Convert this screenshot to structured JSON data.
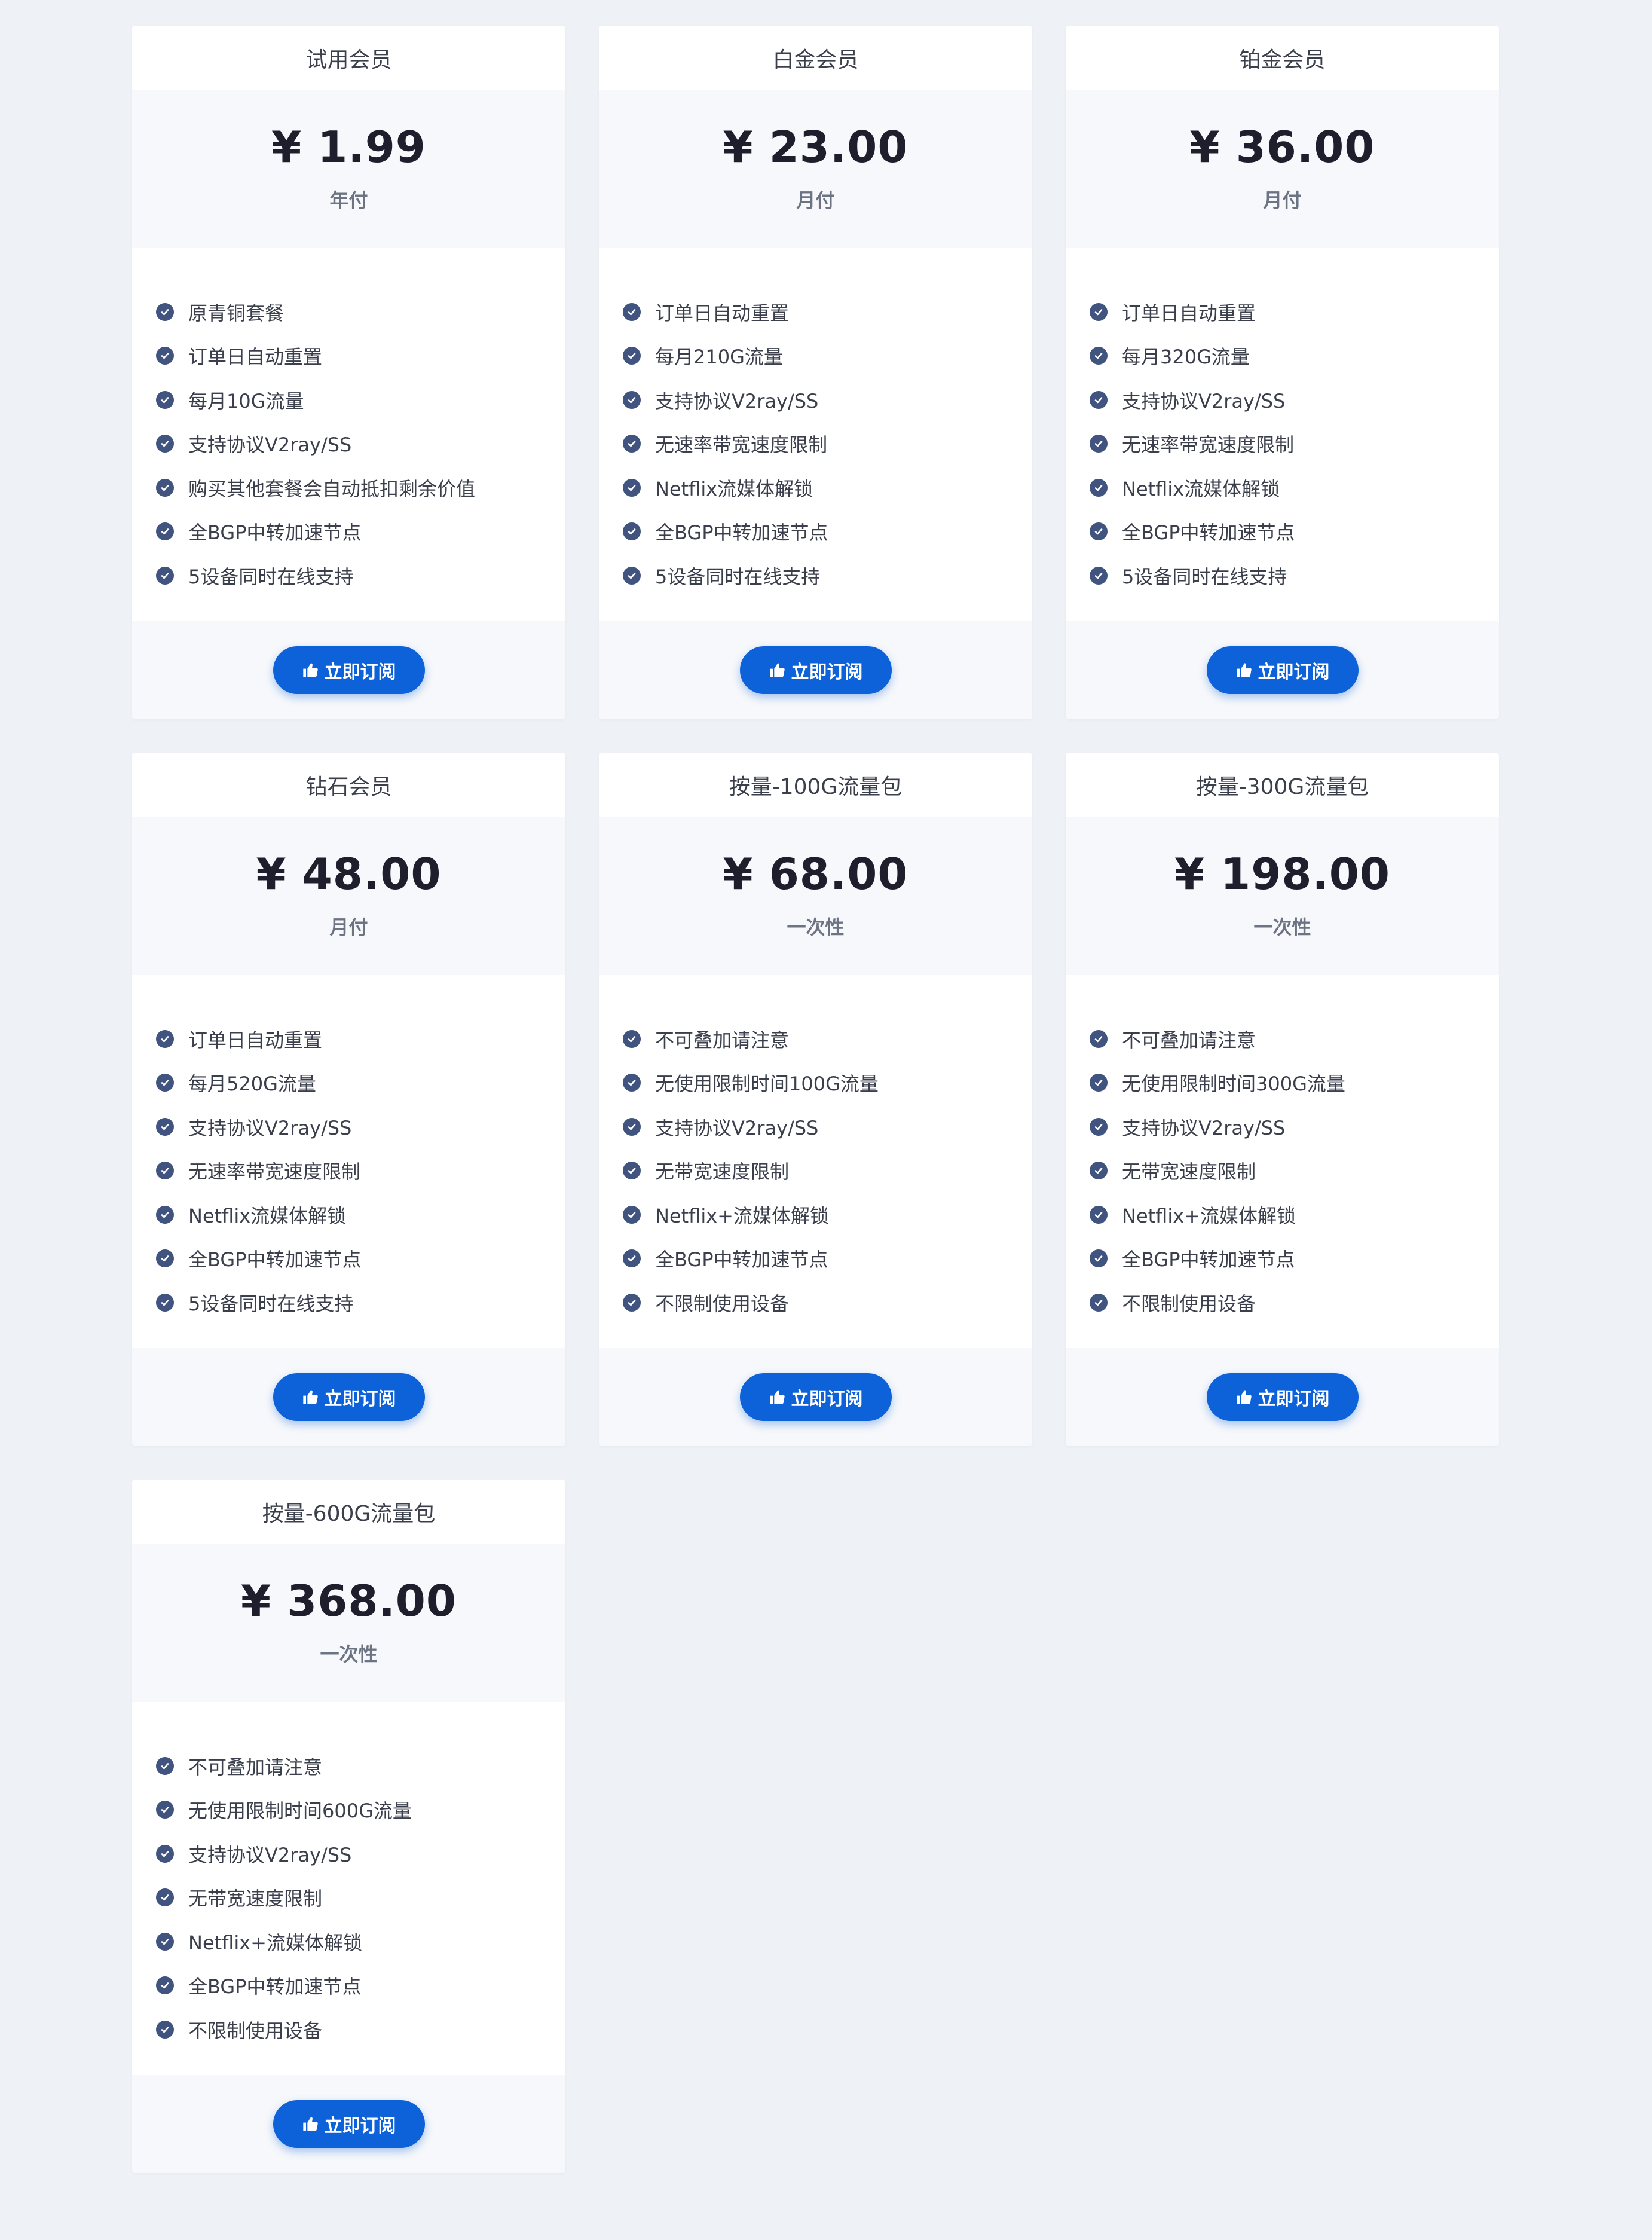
{
  "plans": [
    {
      "name": "试用会员",
      "price": "¥ 1.99",
      "period": "年付",
      "features": [
        "原青铜套餐",
        "订单日自动重置",
        "每月10G流量",
        "支持协议V2ray/SS",
        "购买其他套餐会自动抵扣剩余价值",
        "全BGP中转加速节点",
        "5设备同时在线支持"
      ],
      "button": "立即订阅"
    },
    {
      "name": "白金会员",
      "price": "¥ 23.00",
      "period": "月付",
      "features": [
        "订单日自动重置",
        "每月210G流量",
        "支持协议V2ray/SS",
        "无速率带宽速度限制",
        "Netflix流媒体解锁",
        "全BGP中转加速节点",
        "5设备同时在线支持"
      ],
      "button": "立即订阅"
    },
    {
      "name": "铂金会员",
      "price": "¥ 36.00",
      "period": "月付",
      "features": [
        "订单日自动重置",
        "每月320G流量",
        "支持协议V2ray/SS",
        "无速率带宽速度限制",
        "Netflix流媒体解锁",
        "全BGP中转加速节点",
        "5设备同时在线支持"
      ],
      "button": "立即订阅"
    },
    {
      "name": "钻石会员",
      "price": "¥ 48.00",
      "period": "月付",
      "features": [
        "订单日自动重置",
        "每月520G流量",
        "支持协议V2ray/SS",
        "无速率带宽速度限制",
        "Netflix流媒体解锁",
        "全BGP中转加速节点",
        "5设备同时在线支持"
      ],
      "button": "立即订阅"
    },
    {
      "name": "按量-100G流量包",
      "price": "¥ 68.00",
      "period": "一次性",
      "features": [
        "不可叠加请注意",
        "无使用限制时间100G流量",
        "支持协议V2ray/SS",
        "无带宽速度限制",
        "Netflix+流媒体解锁",
        "全BGP中转加速节点",
        "不限制使用设备"
      ],
      "button": "立即订阅"
    },
    {
      "name": "按量-300G流量包",
      "price": "¥ 198.00",
      "period": "一次性",
      "features": [
        "不可叠加请注意",
        "无使用限制时间300G流量",
        "支持协议V2ray/SS",
        "无带宽速度限制",
        "Netflix+流媒体解锁",
        "全BGP中转加速节点",
        "不限制使用设备"
      ],
      "button": "立即订阅"
    },
    {
      "name": "按量-600G流量包",
      "price": "¥ 368.00",
      "period": "一次性",
      "features": [
        "不可叠加请注意",
        "无使用限制时间600G流量",
        "支持协议V2ray/SS",
        "无带宽速度限制",
        "Netflix+流媒体解锁",
        "全BGP中转加速节点",
        "不限制使用设备"
      ],
      "button": "立即订阅"
    }
  ],
  "icons": {
    "feature": "check-circle-icon",
    "button": "thumbs-up-icon"
  },
  "colors": {
    "background": "#eef2f7",
    "button": "#0d62d9",
    "check": "#40547f"
  }
}
